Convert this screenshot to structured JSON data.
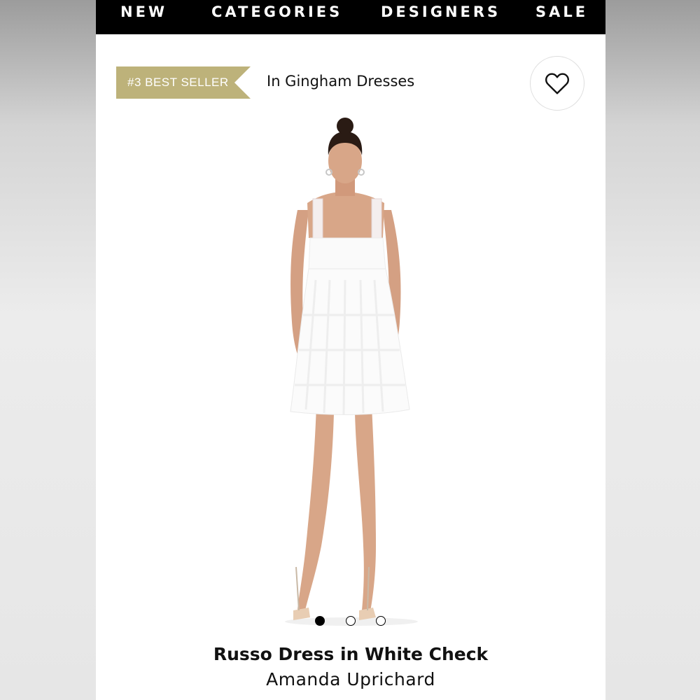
{
  "nav": {
    "items": [
      {
        "label": "NEW"
      },
      {
        "label": "CATEGORIES"
      },
      {
        "label": "DESIGNERS"
      },
      {
        "label": "SALE"
      }
    ]
  },
  "badge": {
    "rank_label": "#3 BEST SELLER",
    "context": "In Gingham Dresses",
    "color": "#bdb27a"
  },
  "favorite": {
    "icon": "heart-icon"
  },
  "carousel": {
    "total": 3,
    "active_index": 0
  },
  "product": {
    "title": "Russo Dress in White Check",
    "designer": "Amanda Uprichard"
  }
}
